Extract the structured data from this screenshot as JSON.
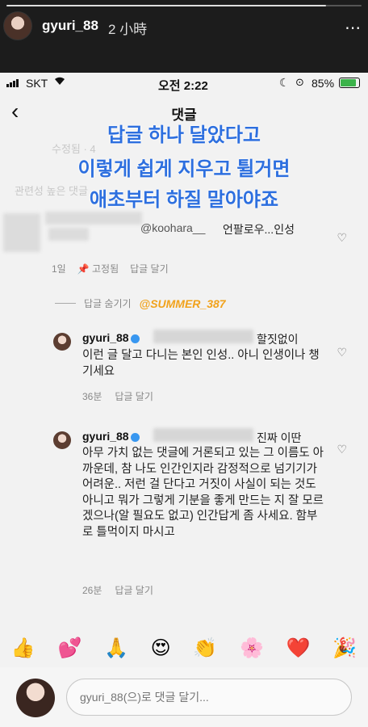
{
  "story": {
    "username": "gyuri_88",
    "time": "2 小時",
    "more": "⋯",
    "progress": 0.9
  },
  "status_bar": {
    "carrier": "SKT",
    "time": "오전 2:22",
    "battery": "85%",
    "battery_level": 0.85
  },
  "nav": {
    "title": "댓글"
  },
  "overlay": {
    "line1": "답글 하나 달았다고",
    "line2": "이렇게 쉽게 지우고 튈거면",
    "line3": "애초부터 하질 말아야죠"
  },
  "faint": {
    "a": "수정됨 · 4",
    "b": "관련성 높은 댓글"
  },
  "comment": {
    "mention": "@koohara__",
    "text": "언팔로우...인성",
    "time": "1일",
    "pinned": "고정됨",
    "reply": "답글 달기"
  },
  "hide_replies": "답글 숨기기",
  "summer": "@SUMMER_387",
  "replies": [
    {
      "username": "gyuri_88",
      "suffix": "할짓없이",
      "body": "이런 글 달고 다니는 본인 인성.. 아니 인생이나 챙기세요",
      "time": "36분",
      "reply": "답글 달기"
    },
    {
      "username": "gyuri_88",
      "suffix": "진짜 이딴",
      "body": "아무 가치 없는 댓글에 거론되고 있는 그 이름도 아까운데, 참 나도 인간인지라 감정적으로 넘기기가 어려운.. 저런 걸 단다고 거짓이 사실이 되는 것도 아니고 뭐가 그렇게 기분을 좋게 만드는 지 잘 모르겠으나(알 필요도 없고) 인간답게 좀 사세요. 함부로 틀먹이지 마시고",
      "time": "26분",
      "reply": "답글 달기"
    }
  ],
  "emojis": [
    "👍",
    "💕",
    "🙏",
    "😍",
    "👏",
    "🌸",
    "❤️",
    "🎉"
  ],
  "compose": {
    "placeholder": "gyuri_88(으)로 댓글 달기..."
  }
}
